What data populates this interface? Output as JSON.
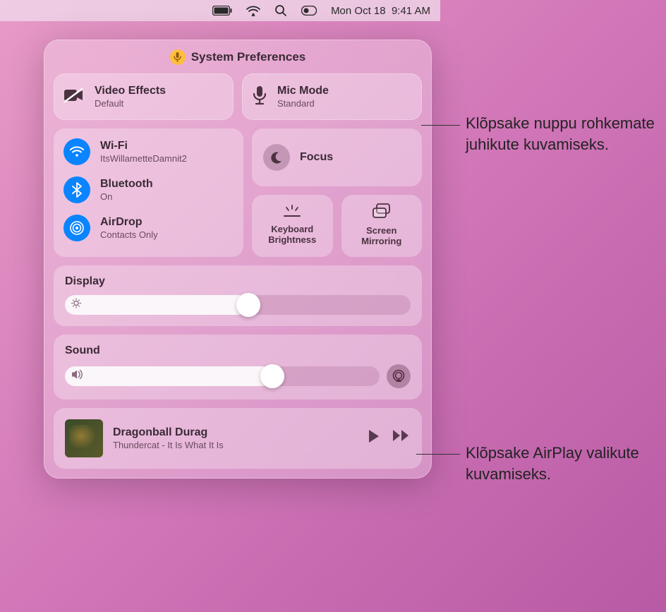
{
  "menubar": {
    "date": "Mon Oct 18",
    "time": "9:41 AM"
  },
  "header": {
    "title": "System Preferences"
  },
  "video_effects": {
    "title": "Video Effects",
    "subtitle": "Default"
  },
  "mic_mode": {
    "title": "Mic Mode",
    "subtitle": "Standard"
  },
  "wifi": {
    "title": "Wi-Fi",
    "subtitle": "ItsWillametteDamnit2"
  },
  "bluetooth": {
    "title": "Bluetooth",
    "subtitle": "On"
  },
  "airdrop": {
    "title": "AirDrop",
    "subtitle": "Contacts Only"
  },
  "focus": {
    "title": "Focus"
  },
  "keyboard_brightness": {
    "label": "Keyboard\nBrightness"
  },
  "screen_mirroring": {
    "label": "Screen\nMirroring"
  },
  "display": {
    "label": "Display",
    "value_percent": 53
  },
  "sound": {
    "label": "Sound",
    "value_percent": 66
  },
  "nowplaying": {
    "title": "Dragonball Durag",
    "subtitle": "Thundercat - It Is What It Is"
  },
  "callouts": {
    "mic_mode": "Klõpsake nuppu rohkemate juhikute kuvamiseks.",
    "airplay": "Klõpsake AirPlay valikute kuvamiseks."
  }
}
